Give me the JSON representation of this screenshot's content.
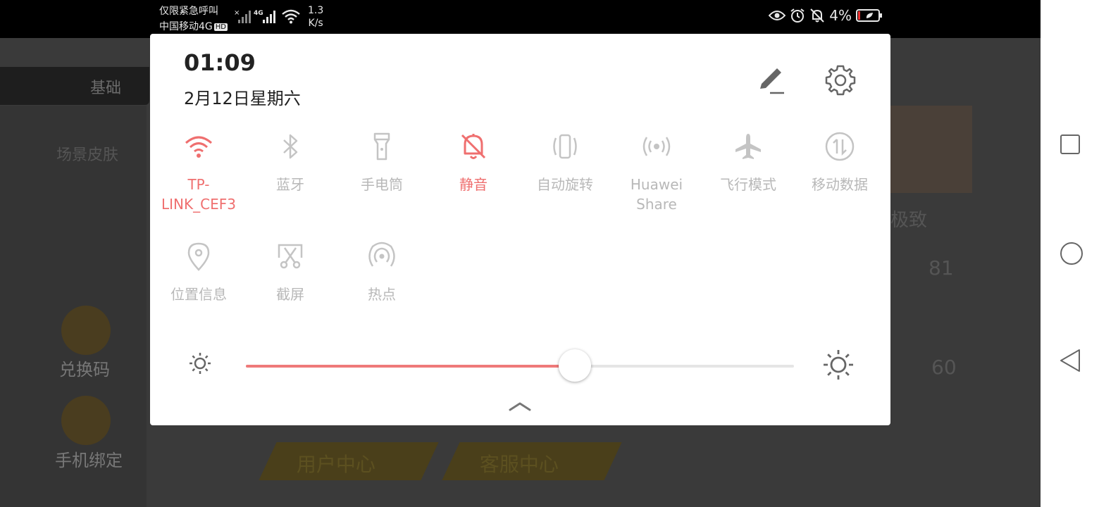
{
  "status_bar": {
    "carrier_line1": "仅限紧急呼叫",
    "carrier_line2": "中国移动4G",
    "hd_badge": "HD",
    "network_label": "4G",
    "speed_value": "1.3",
    "speed_unit": "K/s",
    "battery_percent": "4%"
  },
  "background_app": {
    "tab_label": "基础",
    "menu_item": "场景皮肤",
    "redeem_label": "兑换码",
    "bind_phone_label": "手机绑定",
    "user_center_label": "用户中心",
    "customer_service_label": "客服中心",
    "stat1": "81",
    "stat2": "60",
    "card_text": "极致"
  },
  "panel": {
    "time": "01:09",
    "date": "2月12日星期六",
    "tiles_row1": [
      {
        "label": "TP-LINK_CEF3",
        "icon": "wifi-icon",
        "active": true
      },
      {
        "label": "蓝牙",
        "icon": "bluetooth-icon",
        "active": false
      },
      {
        "label": "手电筒",
        "icon": "flashlight-icon",
        "active": false
      },
      {
        "label": "静音",
        "icon": "bell-off-icon",
        "active": true
      },
      {
        "label": "自动旋转",
        "icon": "auto-rotate-icon",
        "active": false
      },
      {
        "label": "Huawei Share",
        "icon": "huawei-share-icon",
        "active": false
      },
      {
        "label": "飞行模式",
        "icon": "airplane-icon",
        "active": false
      },
      {
        "label": "移动数据",
        "icon": "mobile-data-icon",
        "active": false
      }
    ],
    "tiles_row2": [
      {
        "label": "位置信息",
        "icon": "location-icon",
        "active": false
      },
      {
        "label": "截屏",
        "icon": "screenshot-icon",
        "active": false
      },
      {
        "label": "热点",
        "icon": "hotspot-icon",
        "active": false
      }
    ],
    "brightness_level": 0.6,
    "accent_color": "#ef6f6f"
  }
}
